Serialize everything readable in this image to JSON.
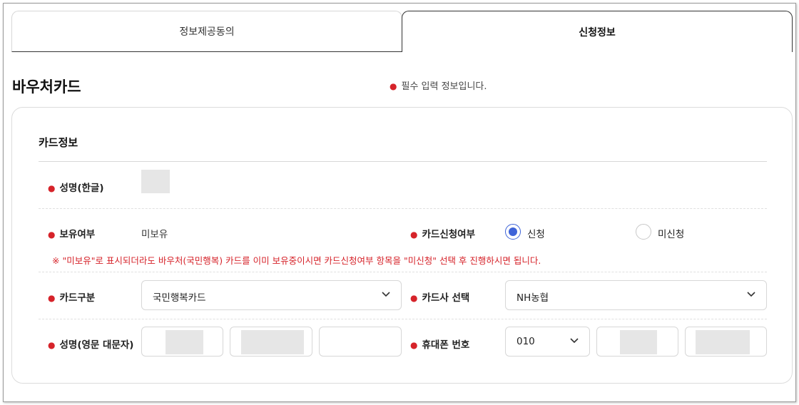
{
  "tabs": [
    {
      "label": "정보제공동의",
      "active": false
    },
    {
      "label": "신청정보",
      "active": true
    }
  ],
  "section": {
    "title": "바우처카드",
    "required_note": "필수 입력 정보입니다."
  },
  "card": {
    "title": "카드정보",
    "fields": {
      "name_korean": {
        "label": "성명(한글)",
        "value": ""
      },
      "ownership": {
        "label": "보유여부",
        "value": "미보유"
      },
      "card_apply": {
        "label": "카드신청여부",
        "options": [
          {
            "label": "신청",
            "checked": true
          },
          {
            "label": "미신청",
            "checked": false
          }
        ]
      },
      "notice": "※ \"미보유\"로 표시되더라도 바우처(국민행복) 카드를 이미 보유중이시면 카드신청여부 항목을 \"미신청\" 선택 후 진행하시면 됩니다.",
      "card_type": {
        "label": "카드구분",
        "selected": "국민행복카드"
      },
      "card_company": {
        "label": "카드사 선택",
        "selected": "NH농협"
      },
      "name_english": {
        "label": "성명(영문 대문자)"
      },
      "phone": {
        "label": "휴대폰 번호",
        "prefix_selected": "010"
      }
    }
  },
  "colors": {
    "required_dot": "#d6232a",
    "radio_accent": "#3e63d8",
    "notice_text": "#d6232a"
  },
  "icons": {
    "required": "dot-icon",
    "select_arrow": "chevron-down-icon"
  }
}
